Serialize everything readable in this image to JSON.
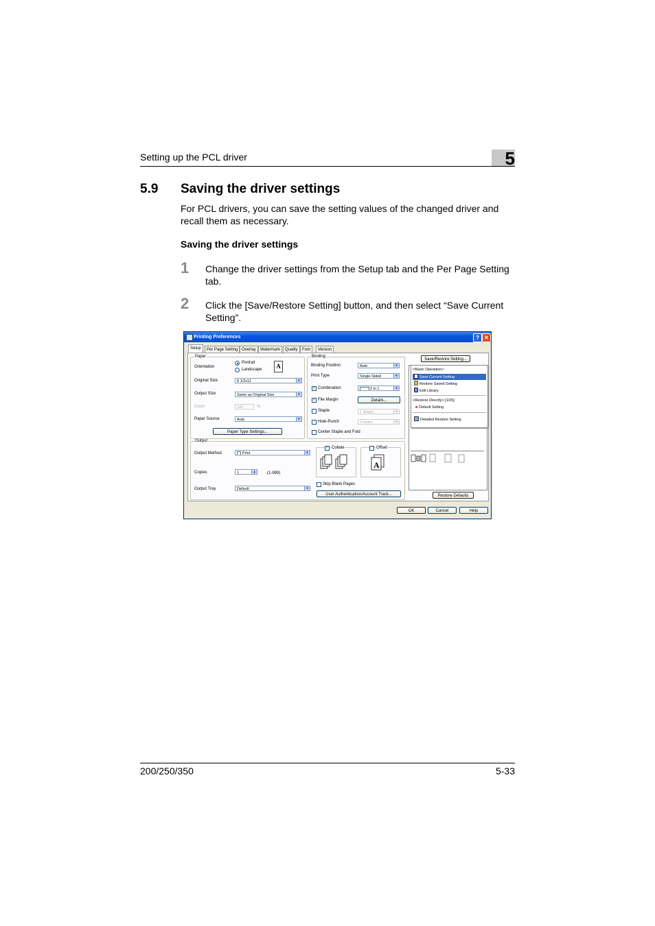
{
  "header": {
    "section_label": "Setting up the PCL driver",
    "chapter": "5"
  },
  "section": {
    "number": "5.9",
    "title": "Saving the driver settings"
  },
  "intro_lines": [
    "For PCL drivers, you can save the setting values of the changed driver and",
    "recall them as necessary."
  ],
  "subheading": "Saving the driver settings",
  "steps": [
    {
      "num": "1",
      "lines": [
        "Change the driver settings from the Setup tab and the Per Page Setting",
        "tab."
      ]
    },
    {
      "num": "2",
      "lines": [
        "Click the [Save/Restore Setting] button, and then select “Save Current",
        "Setting”."
      ]
    }
  ],
  "dialog": {
    "title": "Printing Preferences",
    "help_btn": "?",
    "close_btn": "✕",
    "tabs": [
      "Setup",
      "Per Page Setting",
      "Overlay",
      "Watermark",
      "Quality",
      "Font",
      "Version"
    ],
    "paper": {
      "group": "Paper",
      "orientation_label": "Orientation",
      "portrait": "Portrait",
      "landscape": "Landscape",
      "original_size_label": "Original Size",
      "original_size": "8 1/2x11",
      "output_size_label": "Output Size",
      "output_size": "Same as Original Size",
      "zoom_label": "Zoom",
      "zoom": "100",
      "zoom_unit": "%",
      "paper_source_label": "Paper Source",
      "paper_source": "Auto",
      "paper_type_btn": "Paper Type Settings..."
    },
    "binding": {
      "group": "Binding",
      "binding_position_label": "Binding Position",
      "binding_position": "Auto",
      "print_type_label": "Print Type",
      "print_type": "Single-Sided",
      "combination_label": "Combination",
      "combination": "2 in 1",
      "file_margin_label": "File Margin",
      "details_btn": "Details...",
      "staple_label": "Staple",
      "staple": "1 Staple",
      "hole_punch_label": "Hole-Punch",
      "hole_punch": "2 Holes",
      "center_staple_label": "Center Staple and Fold"
    },
    "output": {
      "group": "Output",
      "output_method_label": "Output Method",
      "output_method": "Print",
      "copies_label": "Copies",
      "copies": "1",
      "copies_range": "(1-999)",
      "output_tray_label": "Output Tray",
      "output_tray": "Default",
      "collate_label": "Collate",
      "offset_label": "Offset",
      "skip_blank_label": "Skip Blank Pages",
      "user_auth_btn": "User Authentication/Account Track..."
    },
    "save_restore_btn": "Save/Restore Setting...",
    "menu": {
      "basic_header": "<Basic Operation>",
      "save_current": "Save Current Setting",
      "restore_saved": "Restore Saved Setting",
      "edit_library": "Edit Library",
      "restore_directly_header": "<Restore Directly> [1/25]",
      "default_setting": "Default Setting",
      "detailed_restore": "Detailed Restore Setting"
    },
    "restore_defaults_btn": "Restore Defaults",
    "ok_btn": "OK",
    "cancel_btn": "Cancel",
    "help_bottom_btn": "Help"
  },
  "footer": {
    "models": "200/250/350",
    "page": "5-33"
  }
}
